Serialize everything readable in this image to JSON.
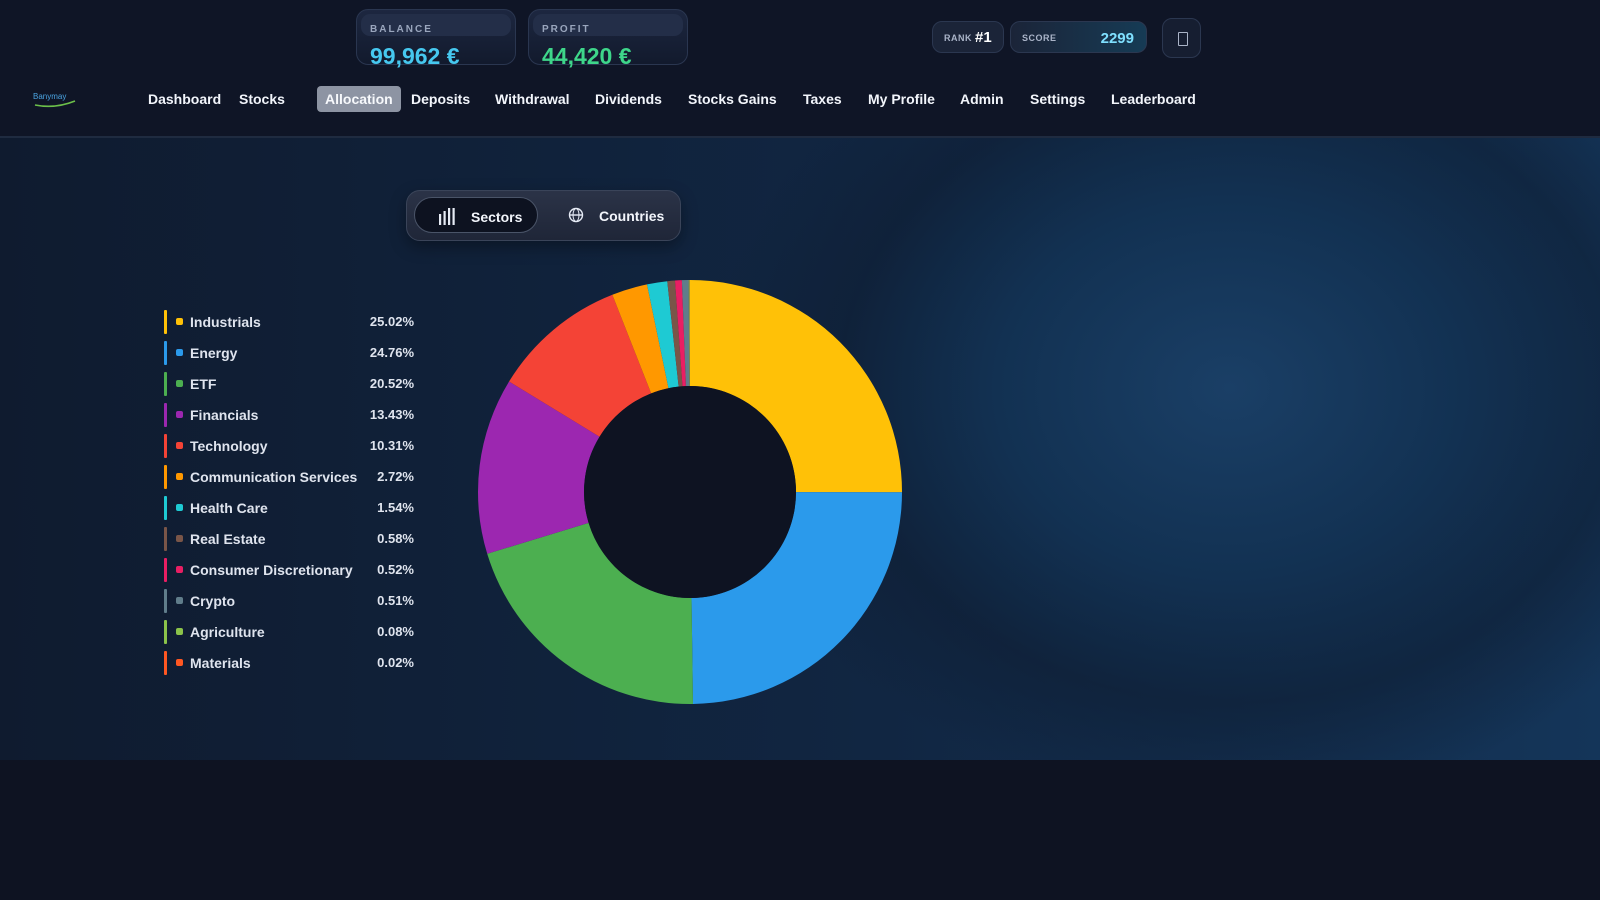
{
  "header": {
    "balance": {
      "label": "BALANCE",
      "value": "99,962 €"
    },
    "profit": {
      "label": "PROFIT",
      "value": "44,420 €"
    },
    "rank": {
      "label": "RANK",
      "value": "#1"
    },
    "score": {
      "label": "SCORE",
      "value": "2299"
    },
    "logo_text": "Banymay"
  },
  "nav": {
    "items": [
      {
        "label": "Dashboard",
        "active": false
      },
      {
        "label": "Stocks",
        "active": false
      },
      {
        "label": "Allocation",
        "active": true
      },
      {
        "label": "Deposits",
        "active": false
      },
      {
        "label": "Withdrawal",
        "active": false
      },
      {
        "label": "Dividends",
        "active": false
      },
      {
        "label": "Stocks Gains",
        "active": false
      },
      {
        "label": "Taxes",
        "active": false
      },
      {
        "label": "My Profile",
        "active": false
      },
      {
        "label": "Admin",
        "active": false
      },
      {
        "label": "Settings",
        "active": false
      },
      {
        "label": "Leaderboard",
        "active": false
      }
    ]
  },
  "toggle": {
    "sectors_label": "Sectors",
    "countries_label": "Countries",
    "selected": "Sectors"
  },
  "chart_data": {
    "type": "pie",
    "donut": true,
    "categories": [
      "Industrials",
      "Energy",
      "ETF",
      "Financials",
      "Technology",
      "Communication Services",
      "Health Care",
      "Real Estate",
      "Consumer Discretionary",
      "Crypto",
      "Agriculture",
      "Materials"
    ],
    "values": [
      25.02,
      24.76,
      20.52,
      13.43,
      10.31,
      2.72,
      1.54,
      0.58,
      0.52,
      0.51,
      0.08,
      0.02
    ],
    "labels": [
      "25.02%",
      "24.76%",
      "20.52%",
      "13.43%",
      "10.31%",
      "2.72%",
      "1.54%",
      "0.58%",
      "0.52%",
      "0.51%",
      "0.08%",
      "0.02%"
    ],
    "colors": [
      "#FFC107",
      "#2B9AEB",
      "#4CAF50",
      "#9C27B0",
      "#F44336",
      "#FF9800",
      "#1ECAD3",
      "#795548",
      "#E91E63",
      "#607D8B",
      "#8BC34A",
      "#FF5722"
    ],
    "legend_position": "left"
  }
}
